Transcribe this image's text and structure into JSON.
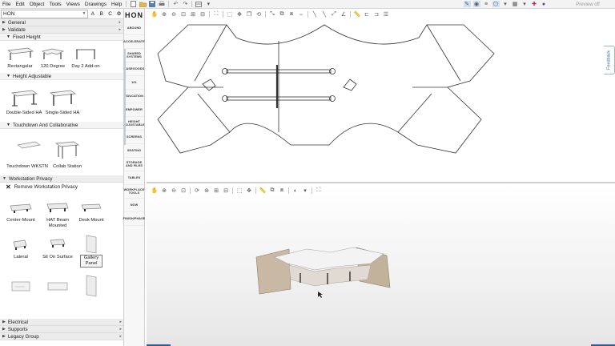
{
  "menu": [
    "File",
    "Edit",
    "Object",
    "Tools",
    "Views",
    "Drawings",
    "Help"
  ],
  "preview_label": "Preview off",
  "catalog": {
    "selected": "HON",
    "letters": [
      "A",
      "B",
      "C"
    ]
  },
  "sections": {
    "general": "General",
    "validate": "Validate",
    "fixed_height": "Fixed Height",
    "height_adjustable": "Height Adjustable",
    "touchdown": "Touchdown And Collaborative",
    "privacy": "Workstation Privacy",
    "electrical": "Electrical",
    "supports": "Supports",
    "legacy": "Legacy Group"
  },
  "fixed_items": [
    "Rectangular",
    "120 Degree",
    "Day 2 Add-on"
  ],
  "ha_items": [
    "Double-Sided HA",
    "Single-Sided HA"
  ],
  "touch_items": [
    "Touchdown WKSTN",
    "Collab Station"
  ],
  "remove_privacy": "Remove Workstation Privacy",
  "privacy_items": [
    "Center-Mount",
    "HAT Beam Mounted",
    "Desk Mount",
    "Lateral",
    "Sit On Surface",
    "Gallery Panel"
  ],
  "brands": {
    "logo": "HON",
    "items": [
      "ABOUND",
      "ACCELERATE",
      "SHARED SYSTEMS",
      "CASEGOODS",
      "101",
      "EDUCATION",
      "EMPOWER",
      "HEIGHT ADJUSTABLE",
      "SCREENS",
      "SEATING",
      "STORAGE AND FILES",
      "TABLES",
      "WORKPLACE TOOLS",
      "NOW",
      "FINISH/PHASE"
    ]
  },
  "feedback_label": "Feedback",
  "colors": {
    "accent": "#2d5aa0",
    "panel": "#c9b9a4"
  }
}
